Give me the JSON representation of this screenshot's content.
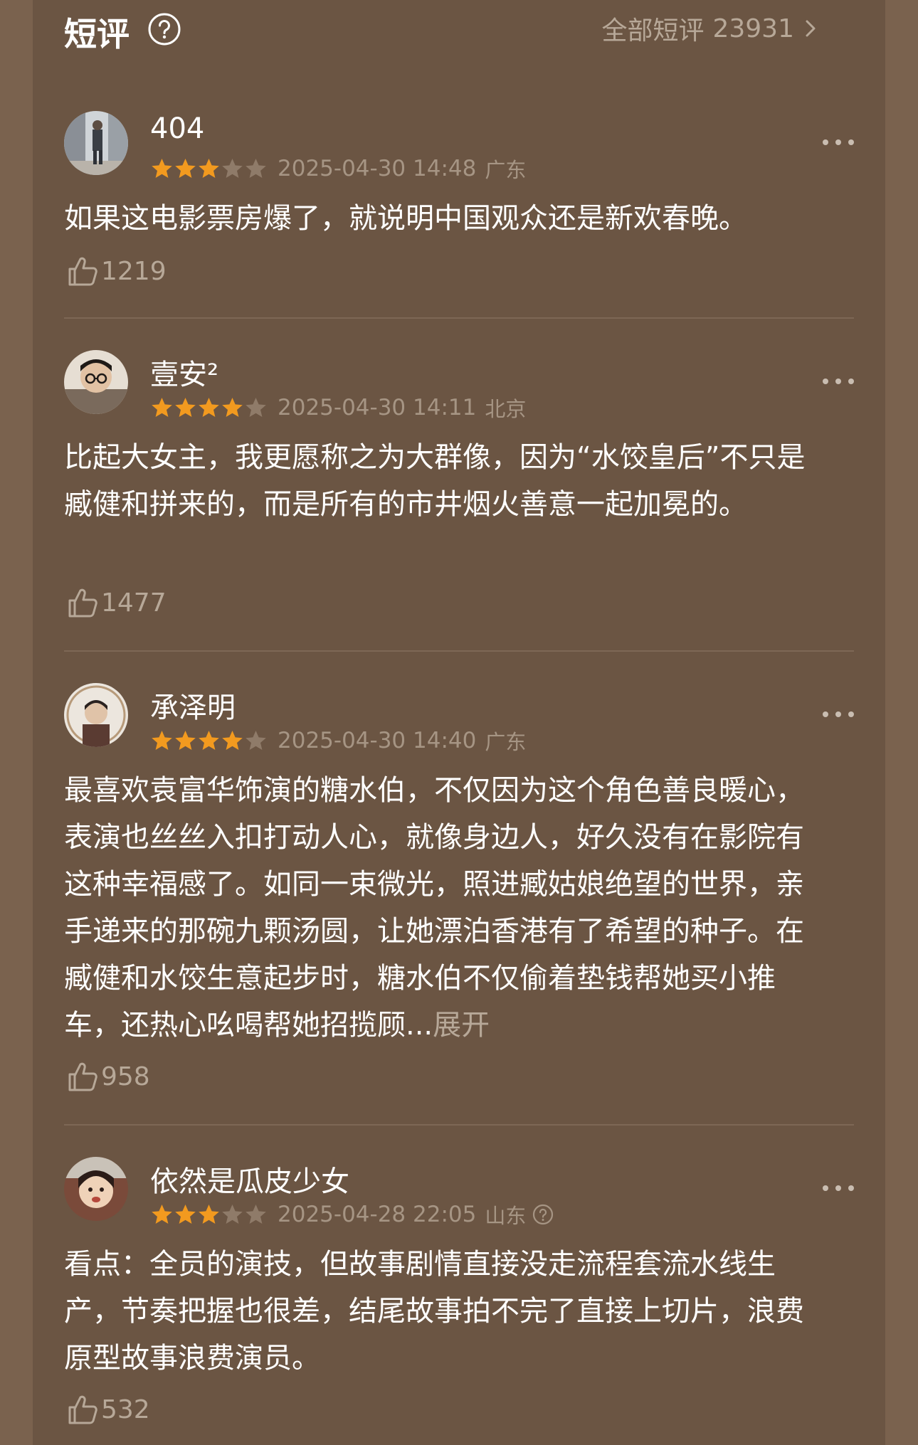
{
  "header": {
    "title": "短评",
    "all_reviews_label": "全部短评",
    "all_reviews_count": "23931"
  },
  "colors": {
    "background": "#6b5543",
    "star_filled": "#f29a1f",
    "star_empty": "#8f7b69",
    "secondary_text": "#b7a898"
  },
  "reviews": [
    {
      "username": "404",
      "stars": 3,
      "date": "2025-04-30 14:48",
      "location": "广东",
      "content": "如果这电影票房爆了，就说明中国观众还是新欢春晚。",
      "likes": "1219"
    },
    {
      "username": "壹安²",
      "stars": 4,
      "date": "2025-04-30 14:11",
      "location": "北京",
      "content": "比起大女主，我更愿称之为大群像，因为“水饺皇后”不只是臧健和拼来的，而是所有的市井烟火善意一起加冕的。",
      "likes": "1477"
    },
    {
      "username": "承泽明",
      "stars": 4,
      "date": "2025-04-30 14:40",
      "location": "广东",
      "content": "最喜欢袁富华饰演的糖水伯，不仅因为这个角色善良暖心，表演也丝丝入扣打动人心，就像身边人，好久没有在影院有这种幸福感了。如同一束微光，照进臧姑娘绝望的世界，亲手递来的那碗九颗汤圆，让她漂泊香港有了希望的种子。在臧健和水饺生意起步时，糖水伯不仅偷着垫钱帮她买小推车，还热心吆喝帮她招揽顾...",
      "expand_label": "展开",
      "likes": "958"
    },
    {
      "username": "依然是瓜皮少女",
      "stars": 3,
      "date": "2025-04-28 22:05",
      "location": "山东",
      "content": "看点：全员的演技，但故事剧情直接没走流程套流水线生产，节奏把握也很差，结尾故事拍不完了直接上切片，浪费原型故事浪费演员。",
      "likes": "532"
    }
  ]
}
